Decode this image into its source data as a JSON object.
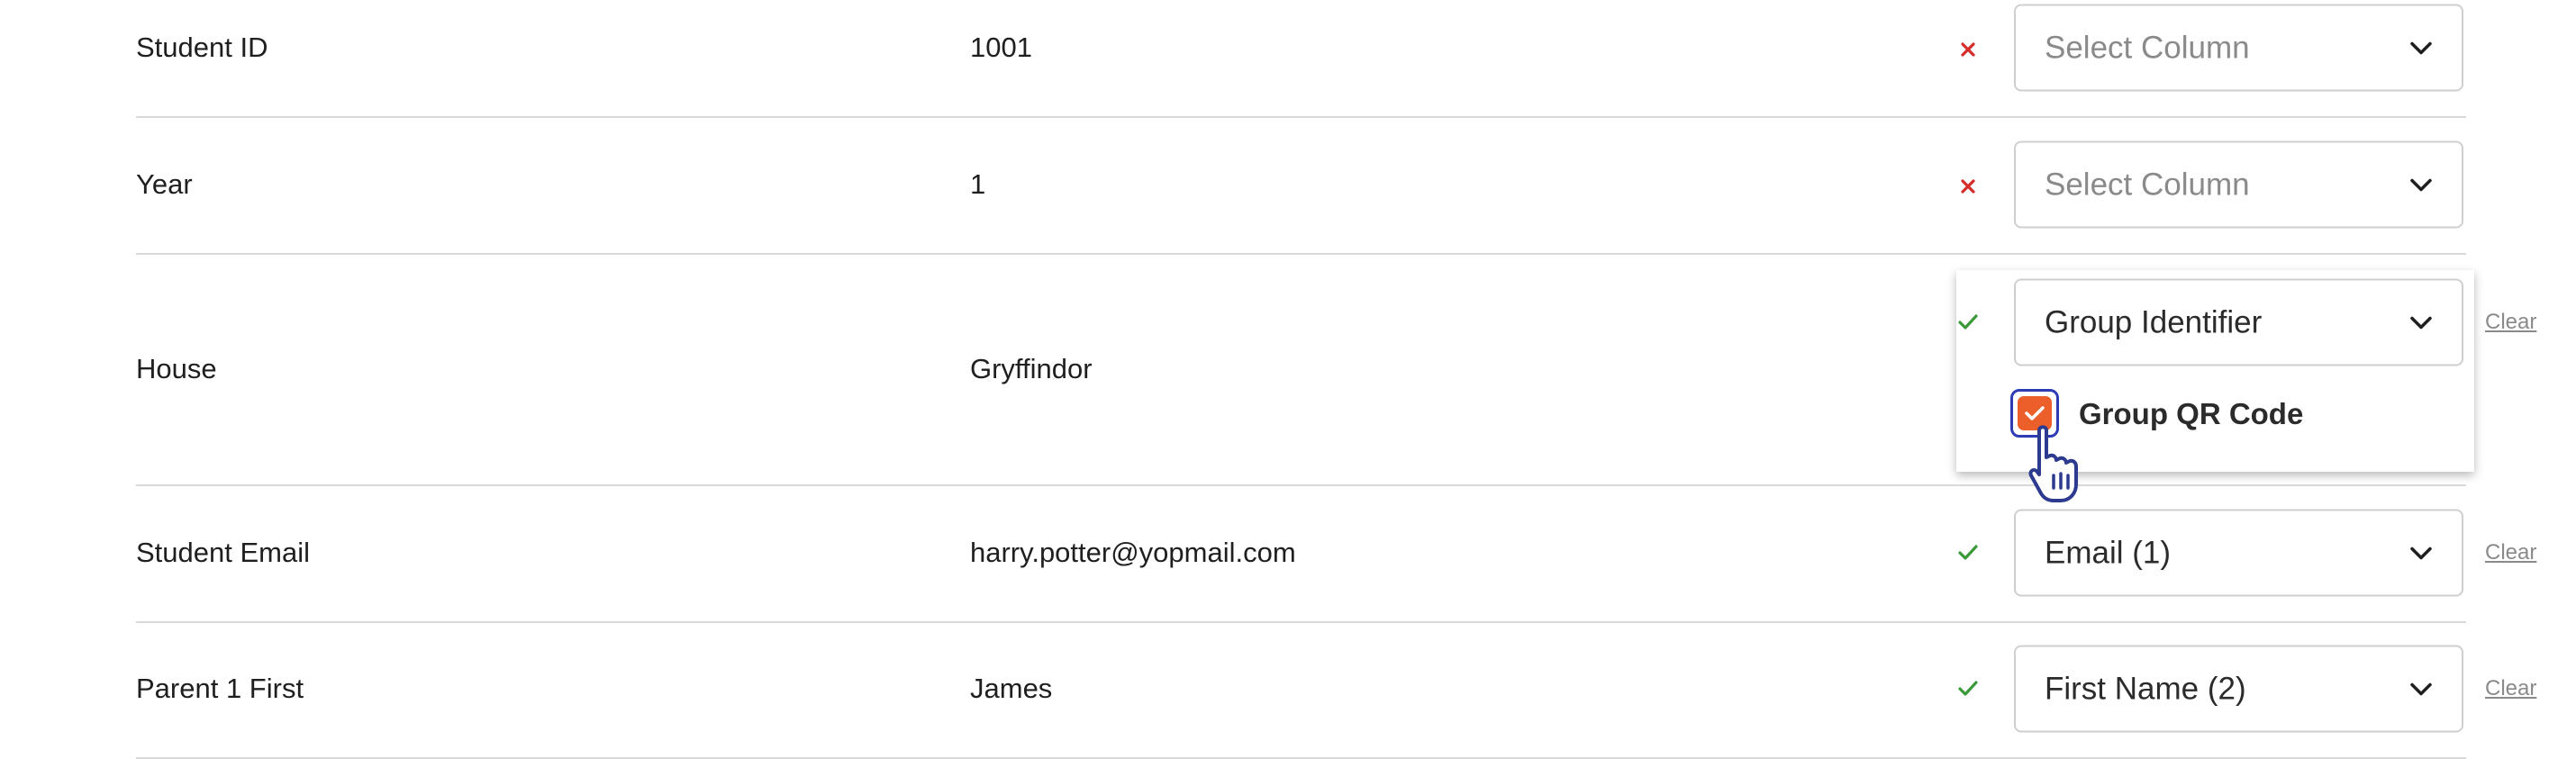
{
  "rows": [
    {
      "label": "Student ID",
      "value": "1001",
      "status": "error",
      "select": "Select Column",
      "select_is_placeholder": true,
      "clear": ""
    },
    {
      "label": "Year",
      "value": "1",
      "status": "error",
      "select": "Select Column",
      "select_is_placeholder": true,
      "clear": ""
    },
    {
      "label": "House",
      "value": "Gryffindor",
      "status": "ok",
      "select": "Group Identifier",
      "select_is_placeholder": false,
      "clear": "Clear"
    },
    {
      "label": "Student Email",
      "value": "harry.potter@yopmail.com",
      "status": "ok",
      "select": "Email (1)",
      "select_is_placeholder": false,
      "clear": "Clear"
    },
    {
      "label": "Parent 1 First",
      "value": "James",
      "status": "ok",
      "select": "First Name (2)",
      "select_is_placeholder": false,
      "clear": "Clear"
    }
  ],
  "group_option": {
    "label": "Group QR Code",
    "checked": true
  },
  "colors": {
    "error": "#d62b2b",
    "ok": "#3a9a3a",
    "checkbox": "#ec5f2a",
    "focus_ring": "#2d3bb5"
  },
  "icons": {
    "error": "x-icon",
    "ok": "check-icon",
    "select": "chevron-down-icon",
    "checkbox": "check-icon",
    "cursor": "hand-pointer-icon"
  }
}
